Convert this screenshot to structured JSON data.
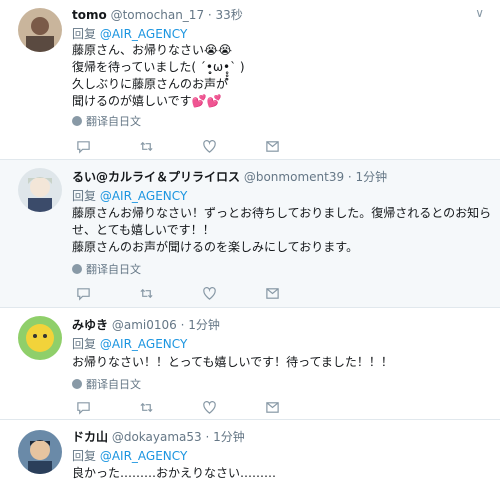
{
  "tweets": [
    {
      "name": "tomo",
      "handle": "@tomochan_17",
      "time": "· 33秒",
      "reply_prefix": "回复",
      "reply_to": "@AIR_AGENCY",
      "lines": [
        "藤原さん、お帰りなさい😭😭",
        "復帰を待っていました( ´•̥̥̥ω•̥̥̥` )",
        "久しぶりに藤原さんのお声が",
        "聞けるのが嬉しいです💕💕"
      ],
      "translate": "翻译自日文",
      "highlight": false
    },
    {
      "name": "るい@カルライ＆プリライロス",
      "handle": "@bonmoment39",
      "time": "· 1分钟",
      "reply_prefix": "回复",
      "reply_to": "@AIR_AGENCY",
      "lines": [
        "藤原さんお帰りなさい！ずっとお待ちしておりました。復帰されるとのお知ら",
        "せ、とても嬉しいです！！",
        "藤原さんのお声が聞けるのを楽しみにしております。"
      ],
      "translate": "翻译自日文",
      "highlight": true
    },
    {
      "name": "みゆき",
      "handle": "@ami0106",
      "time": "· 1分钟",
      "reply_prefix": "回复",
      "reply_to": "@AIR_AGENCY",
      "lines": [
        "お帰りなさい！！とっても嬉しいです！待ってました！！！"
      ],
      "translate": "翻译自日文",
      "highlight": false
    },
    {
      "name": "ドカ山",
      "handle": "@dokayama53",
      "time": "· 1分钟",
      "reply_prefix": "回复",
      "reply_to": "@AIR_AGENCY",
      "lines": [
        "良かった………おかえりなさい………"
      ],
      "translate": "",
      "highlight": false
    }
  ],
  "icons": {
    "reply": "reply-icon",
    "retweet": "retweet-icon",
    "like": "heart-icon",
    "dm": "message-icon",
    "caret": "chevron-down-icon",
    "translate": "globe-icon"
  }
}
